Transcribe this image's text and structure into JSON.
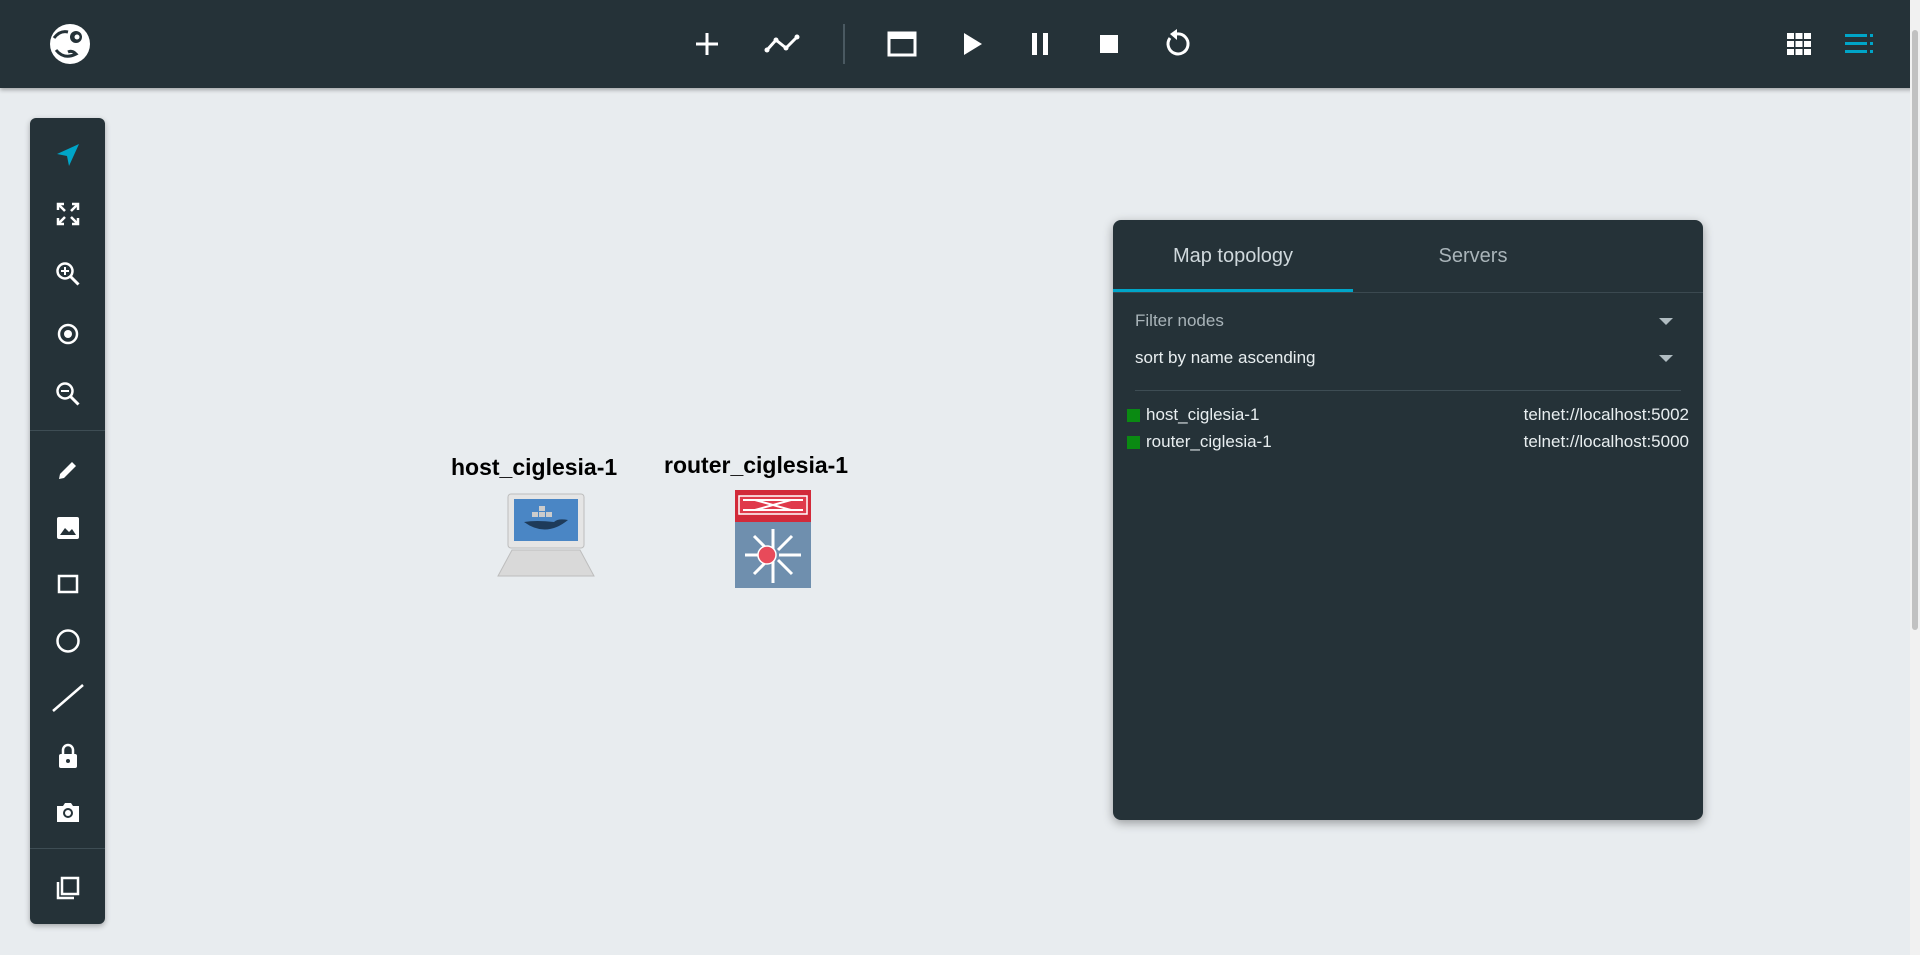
{
  "toolbar": {
    "add_node": "add-icon",
    "add_link": "link-icon",
    "console": "console-window-icon",
    "start": "play-icon",
    "suspend": "pause-icon",
    "stop": "stop-icon",
    "reload": "reload-icon",
    "layout_grid": "grid-icon",
    "topology_summary": "list-icon"
  },
  "left_tools": [
    "select-pointer-icon",
    "fit-screen-icon",
    "zoom-in-icon",
    "reset-zoom-icon",
    "zoom-out-icon",
    "draw-pencil-icon",
    "add-image-icon",
    "rectangle-icon",
    "ellipse-icon",
    "line-icon",
    "lock-icon",
    "screenshot-camera-icon",
    "layers-icon"
  ],
  "nodes": [
    {
      "label": "host_ciglesia-1"
    },
    {
      "label": "router_ciglesia-1"
    }
  ],
  "topology_panel": {
    "tabs": [
      {
        "label": "Map topology"
      },
      {
        "label": "Servers"
      }
    ],
    "filter_placeholder": "Filter nodes",
    "sort_value": "sort by name ascending",
    "rows": [
      {
        "name": "host_ciglesia-1",
        "console": "telnet://localhost:5002",
        "status_color": "#0a8a12"
      },
      {
        "name": "router_ciglesia-1",
        "console": "telnet://localhost:5000",
        "status_color": "#0a8a12"
      }
    ]
  },
  "colors": {
    "accent": "#00a5c8",
    "panel_bg": "#253238",
    "canvas_bg": "#e8ecef"
  }
}
